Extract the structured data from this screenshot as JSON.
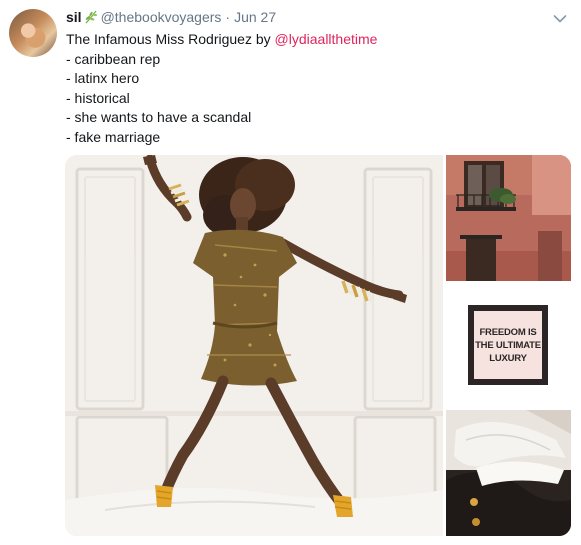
{
  "tweet": {
    "display_name": "sil",
    "handle": "@thebookvoyagers",
    "separator": "·",
    "date": "Jun 27",
    "caret_icon": "chevron-down-icon",
    "name_icon": "sprig-icon",
    "lines": [
      {
        "before": "The Infamous Miss Rodriguez by ",
        "mention": "@lydiaallthetime"
      },
      {
        "text": "- caribbean rep"
      },
      {
        "text": "- latinx hero"
      },
      {
        "text": "- historical"
      },
      {
        "text": "- she wants to have a scandal"
      },
      {
        "text": "- fake marriage"
      }
    ],
    "colors": {
      "mention": "#e0245e",
      "secondary": "#657786",
      "sprig": "#79b04c"
    }
  },
  "media": {
    "quote_card": {
      "lines": [
        "FREEDOM IS",
        "THE ULTIMATE",
        "LUXURY"
      ]
    }
  }
}
